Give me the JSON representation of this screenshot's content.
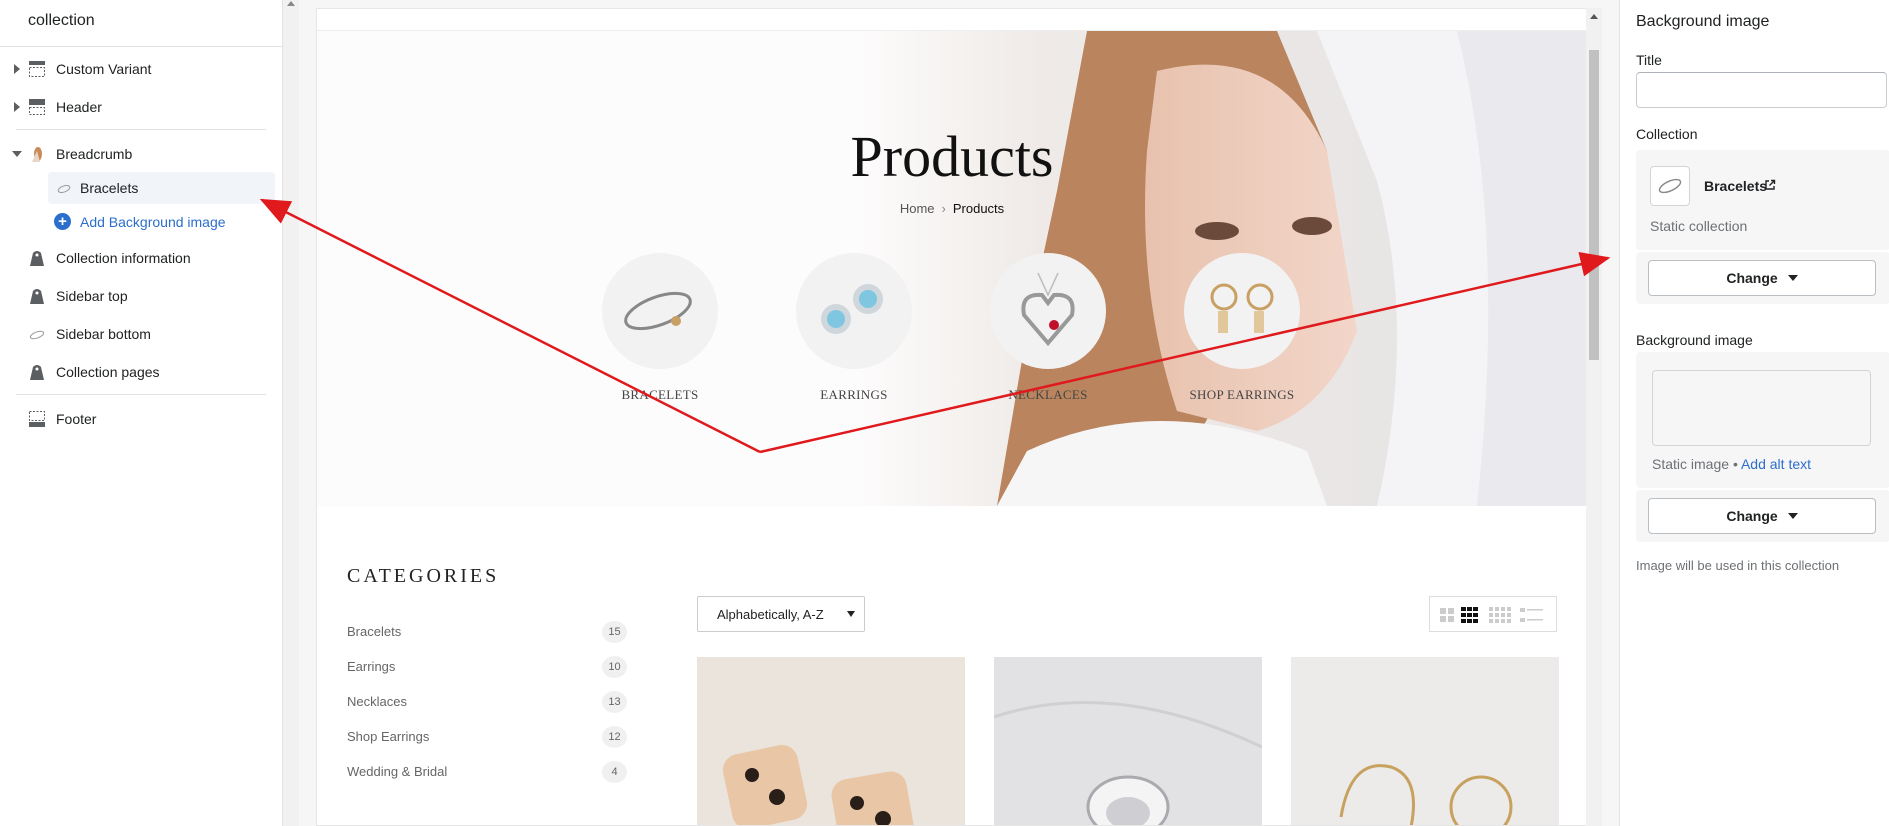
{
  "sidebar": {
    "title": "collection",
    "items": [
      {
        "label": "Custom Variant"
      },
      {
        "label": "Header"
      },
      {
        "label": "Breadcrumb"
      },
      {
        "label": "Collection information"
      },
      {
        "label": "Sidebar top"
      },
      {
        "label": "Sidebar bottom"
      },
      {
        "label": "Collection pages"
      },
      {
        "label": "Footer"
      }
    ],
    "breadcrumb_children": {
      "selected": "Bracelets",
      "add_label": "Add Background image"
    }
  },
  "preview": {
    "hero_title": "Products",
    "breadcrumb": {
      "home": "Home",
      "current": "Products"
    },
    "featured_categories": [
      "BRACELETS",
      "EARRINGS",
      "NECKLACES",
      "SHOP EARRINGS"
    ],
    "categories_heading": "CATEGORIES",
    "categories": [
      {
        "name": "Bracelets",
        "count": "15"
      },
      {
        "name": "Earrings",
        "count": "10"
      },
      {
        "name": "Necklaces",
        "count": "13"
      },
      {
        "name": "Shop Earrings",
        "count": "12"
      },
      {
        "name": "Wedding & Bridal",
        "count": "4"
      }
    ],
    "sort_value": "Alphabetically, A-Z"
  },
  "panel": {
    "heading": "Background image",
    "title_label": "Title",
    "title_value": "",
    "collection_label": "Collection",
    "collection_name": "Bracelets",
    "collection_type": "Static collection",
    "change_label": "Change",
    "bg_label": "Background image",
    "static_image": "Static image",
    "bullet": "•",
    "alt_text_link": "Add alt text",
    "help_text": "Image will be used in this collection"
  },
  "colors": {
    "accent_link": "#2c6ecb",
    "annotation_arrow": "#e0191c",
    "selected_row": "#f1f4f8"
  },
  "icons": {
    "section": "section-dashed-icon",
    "collection": "collection-tag-icon",
    "plus": "plus-circle-icon",
    "external": "external-link-icon"
  }
}
